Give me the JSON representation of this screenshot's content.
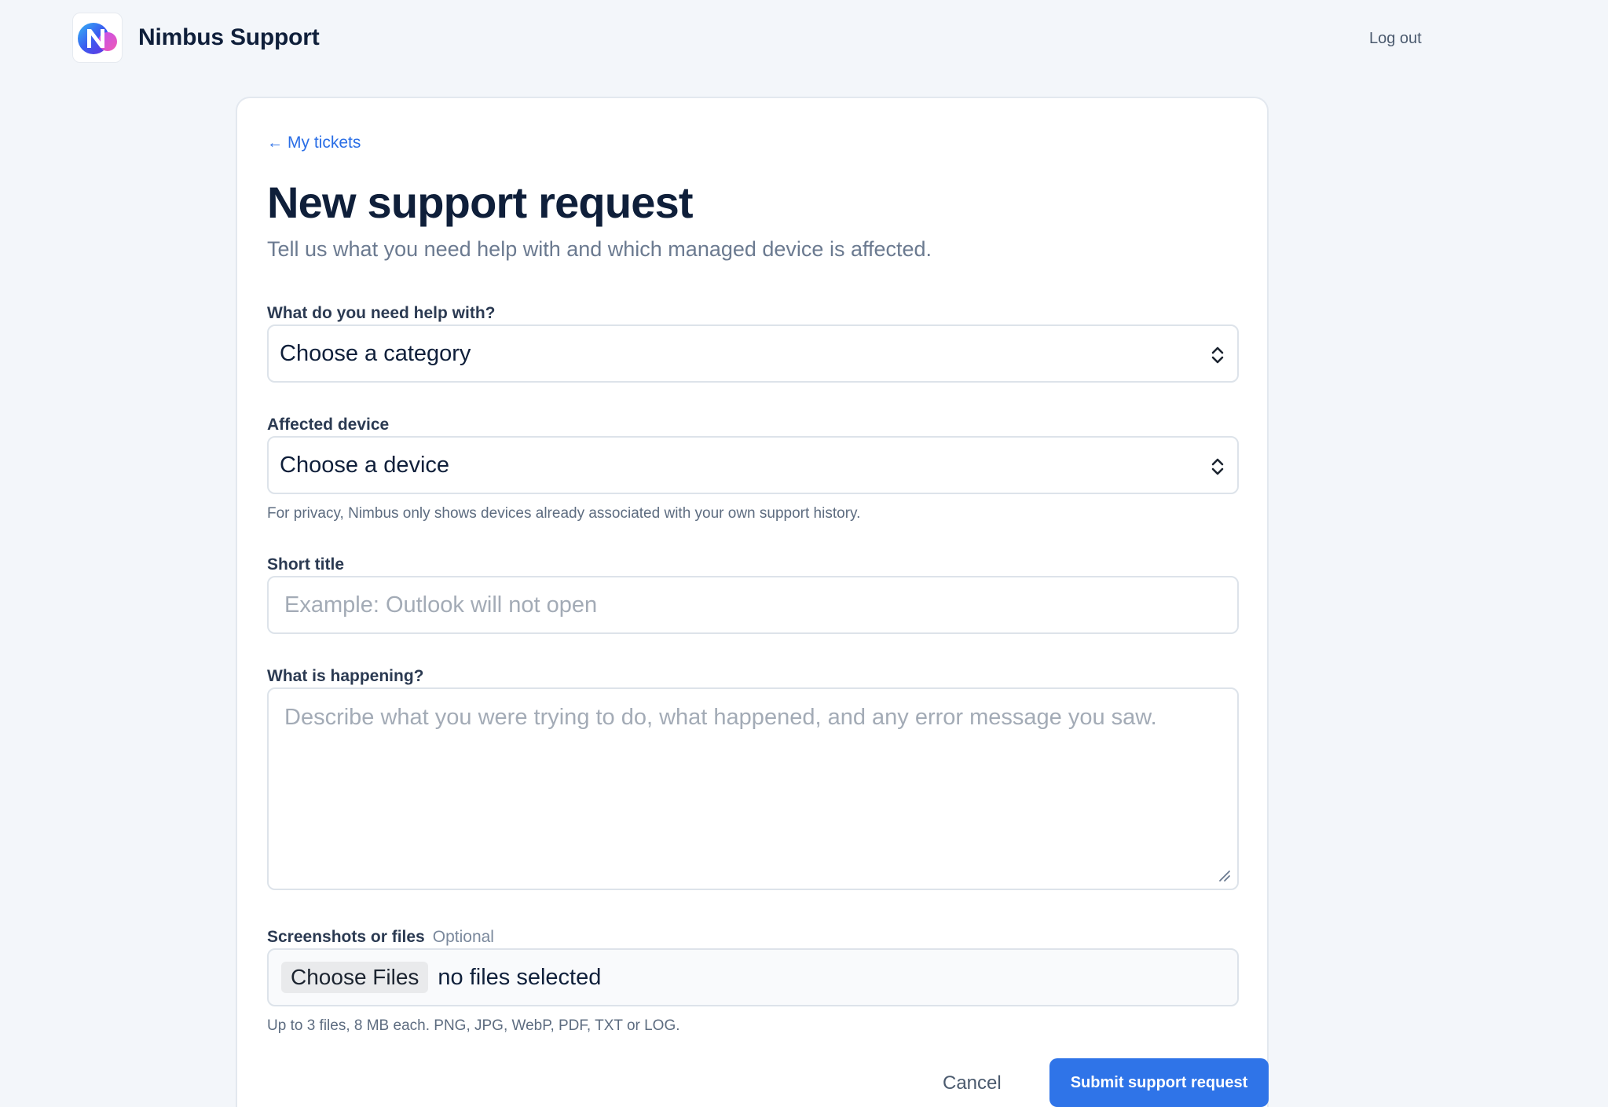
{
  "brand": {
    "name": "Nimbus Support"
  },
  "header": {
    "logout_label": "Log out"
  },
  "nav": {
    "back_label": "My tickets"
  },
  "page": {
    "title": "New support request",
    "subtitle": "Tell us what you need help with and which managed device is affected."
  },
  "form": {
    "category": {
      "label": "What do you need help with?",
      "selected": "Choose a category"
    },
    "device": {
      "label": "Affected device",
      "selected": "Choose a device",
      "hint": "For privacy, Nimbus only shows devices already associated with your own support history."
    },
    "title": {
      "label": "Short title",
      "placeholder": "Example: Outlook will not open",
      "value": ""
    },
    "description": {
      "label": "What is happening?",
      "placeholder": "Describe what you were trying to do, what happened, and any error message you saw.",
      "value": ""
    },
    "files": {
      "label": "Screenshots or files",
      "optional_label": "Optional",
      "button_label": "Choose Files",
      "status": "no files selected",
      "hint": "Up to 3 files, 8 MB each. PNG, JPG, WebP, PDF, TXT or LOG."
    },
    "actions": {
      "cancel_label": "Cancel",
      "submit_label": "Submit support request"
    }
  },
  "colors": {
    "accent": "#2f74e8",
    "link": "#2a6ee6",
    "background": "#f3f6fa",
    "heading": "#0f1f3a"
  },
  "icons": {
    "logo": "nimbus-logo-icon",
    "back": "arrow-left-icon",
    "select": "chevron-up-down-icon",
    "resize": "resize-grip-icon"
  }
}
